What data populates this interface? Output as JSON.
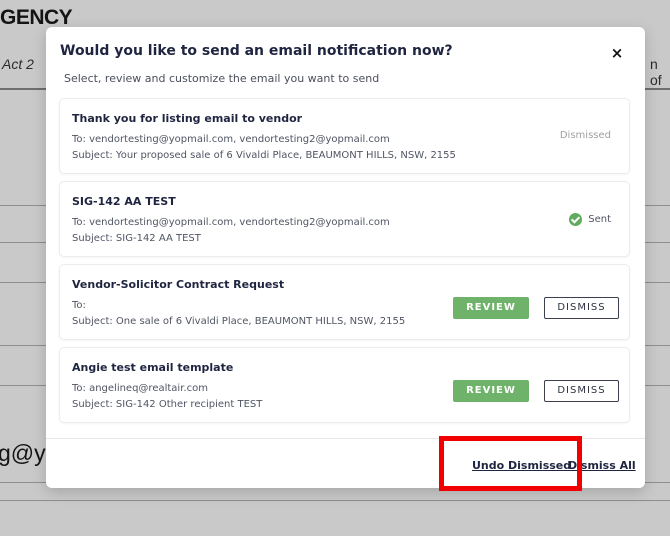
{
  "background": {
    "heading": "GENCY",
    "subtitle_left": "Act 2",
    "subtitle_right": "n of",
    "email_fragment": "g@yc"
  },
  "modal": {
    "title": "Would you like to send an email notification now?",
    "close_label": "×",
    "subtitle": "Select, review and customize the email you want to send",
    "emails": [
      {
        "title": "Thank you for listing email to vendor",
        "to": "To: vendortesting@yopmail.com, vendortesting2@yopmail.com",
        "subject": "Subject: Your proposed sale of 6 Vivaldi Place, BEAUMONT HILLS, NSW, 2155",
        "status": "Dismissed"
      },
      {
        "title": "SIG-142 AA TEST",
        "to": "To: vendortesting@yopmail.com, vendortesting2@yopmail.com",
        "subject": "Subject: SIG-142 AA TEST",
        "status": "Sent"
      },
      {
        "title": "Vendor-Solicitor Contract Request",
        "to": "To:",
        "subject": "Subject: One sale of 6 Vivaldi Place, BEAUMONT HILLS, NSW, 2155",
        "review_label": "REVIEW",
        "dismiss_label": "DISMISS"
      },
      {
        "title": "Angie test email template",
        "to": "To: angelineq@realtair.com",
        "subject": "Subject: SIG-142 Other recipient TEST",
        "review_label": "REVIEW",
        "dismiss_label": "DISMISS"
      }
    ],
    "footer": {
      "undo_dismissed": "Undo Dismissed",
      "dismiss_all": "Dismiss All"
    }
  },
  "colors": {
    "review_green": "#6fb36a",
    "sent_check_green": "#5fab5f",
    "highlight_red": "#f20000",
    "overlay_gray": "#c9c9c9"
  },
  "icons": {
    "close": "close-icon",
    "sent": "check-circle-icon"
  }
}
